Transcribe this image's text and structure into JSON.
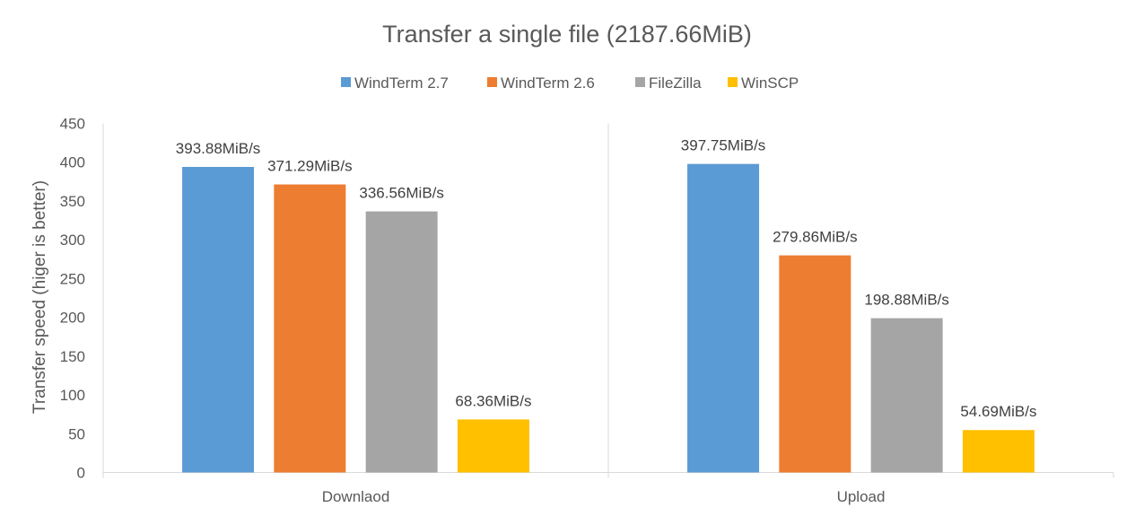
{
  "chart_data": {
    "type": "bar",
    "title": "Transfer a single file (2187.66MiB)",
    "xlabel": "",
    "ylabel": "Transfer speed (higer is better)",
    "ylim": [
      0,
      450
    ],
    "yticks": [
      0,
      50,
      100,
      150,
      200,
      250,
      300,
      350,
      400,
      450
    ],
    "grid": false,
    "legend_position": "top",
    "categories": [
      "Downlaod",
      "Upload"
    ],
    "series": [
      {
        "name": "WindTerm 2.7",
        "color": "#5B9BD5",
        "values": [
          393.88,
          397.75
        ],
        "labels": [
          "393.88MiB/s",
          "397.75MiB/s"
        ]
      },
      {
        "name": "WindTerm 2.6",
        "color": "#ED7D31",
        "values": [
          371.29,
          279.86
        ],
        "labels": [
          "371.29MiB/s",
          "279.86MiB/s"
        ]
      },
      {
        "name": "FileZilla",
        "color": "#A5A5A5",
        "values": [
          336.56,
          198.88
        ],
        "labels": [
          "336.56MiB/s",
          "198.88MiB/s"
        ]
      },
      {
        "name": "WinSCP",
        "color": "#FFC000",
        "values": [
          68.36,
          54.69
        ],
        "labels": [
          "68.36MiB/s",
          "54.69MiB/s"
        ]
      }
    ]
  }
}
